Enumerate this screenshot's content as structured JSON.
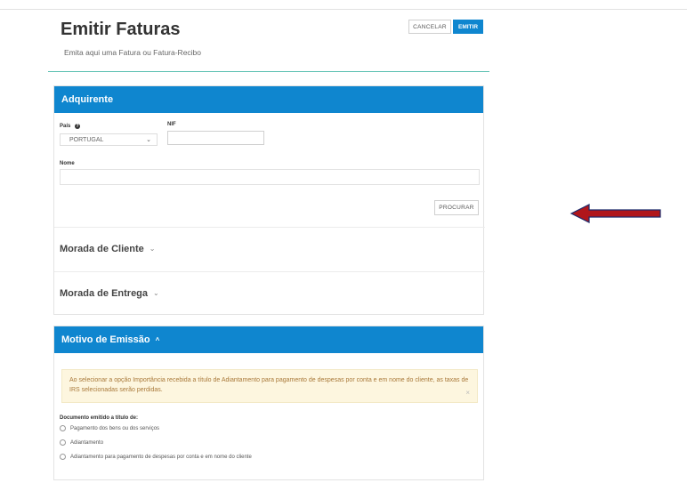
{
  "header": {
    "title": "Emitir Faturas",
    "subtitle": "Emita aqui uma Fatura ou Fatura-Recibo",
    "cancel_label": "CANCELAR",
    "emit_label": "EMITIR"
  },
  "adquirente": {
    "heading": "Adquirente",
    "pais_label": "País",
    "pais_value": "PORTUGAL",
    "nif_label": "NIF",
    "nif_value": "",
    "nome_label": "Nome",
    "nome_value": "",
    "procurar_label": "PROCURAR"
  },
  "morada_cliente": {
    "heading": "Morada de Cliente"
  },
  "morada_entrega": {
    "heading": "Morada de Entrega"
  },
  "motivo": {
    "heading": "Motivo de Emissão",
    "alert_text": "Ao selecionar a opção Importância recebida a título de Adiantamento para pagamento de despesas por conta e em nome do cliente, as taxas de IRS selecionadas serão perdidas.",
    "doc_label": "Documento emitido a título de:",
    "options": [
      "Pagamento dos bens ou dos serviços",
      "Adiantamento",
      "Adiantamento para pagamento de despesas por conta e em nome do cliente"
    ]
  },
  "colors": {
    "accent": "#0f86cf",
    "arrow": "#b0161b"
  },
  "icons": {
    "help": "help-circle-icon",
    "chevron": "chevron-down-icon",
    "close": "close-icon"
  }
}
